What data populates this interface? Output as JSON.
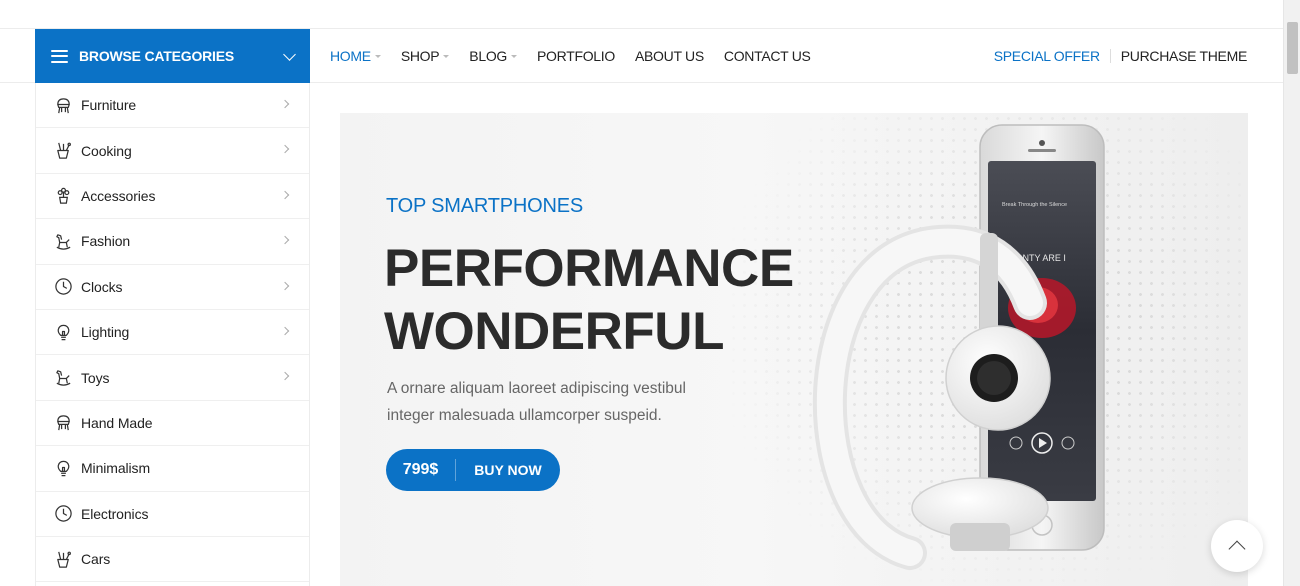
{
  "header": {
    "browse_label": "BROWSE CATEGORIES",
    "nav": [
      {
        "label": "HOME",
        "active": true,
        "has_caret": true
      },
      {
        "label": "SHOP",
        "active": false,
        "has_caret": true
      },
      {
        "label": "BLOG",
        "active": false,
        "has_caret": true
      },
      {
        "label": "PORTFOLIO",
        "active": false,
        "has_caret": false
      },
      {
        "label": "ABOUT US",
        "active": false,
        "has_caret": false
      },
      {
        "label": "CONTACT US",
        "active": false,
        "has_caret": false
      }
    ],
    "special_offer": "SPECIAL OFFER",
    "purchase_theme": "PURCHASE THEME"
  },
  "sidebar": {
    "items": [
      {
        "label": "Furniture",
        "icon": "chair-icon",
        "has_arrow": true
      },
      {
        "label": "Cooking",
        "icon": "kitchen-utensils-icon",
        "has_arrow": true
      },
      {
        "label": "Accessories",
        "icon": "plant-icon",
        "has_arrow": true
      },
      {
        "label": "Fashion",
        "icon": "rocking-horse-icon",
        "has_arrow": true
      },
      {
        "label": "Clocks",
        "icon": "clock-icon",
        "has_arrow": true
      },
      {
        "label": "Lighting",
        "icon": "lightbulb-icon",
        "has_arrow": true
      },
      {
        "label": "Toys",
        "icon": "rocking-horse-icon",
        "has_arrow": true
      },
      {
        "label": "Hand Made",
        "icon": "chair-icon",
        "has_arrow": false
      },
      {
        "label": "Minimalism",
        "icon": "lightbulb-icon",
        "has_arrow": false
      },
      {
        "label": "Electronics",
        "icon": "clock-icon",
        "has_arrow": false
      },
      {
        "label": "Cars",
        "icon": "kitchen-utensils-icon",
        "has_arrow": false
      }
    ]
  },
  "hero": {
    "eyebrow": "TOP SMARTPHONES",
    "title_line1": "PERFORMANCE",
    "title_line2": "WONDERFUL",
    "description": "A ornare aliquam laoreet adipiscing vestibul integer malesuada ullamcorper suspeid.",
    "price": "799$",
    "buy_label": "BUY NOW",
    "phone_screen": {
      "song": "Break Through the Silence",
      "album_title": "MONTY ARE I"
    }
  },
  "colors": {
    "accent": "#0b72c6",
    "text": "#222222",
    "hero_bg": "#f3f3f3"
  }
}
